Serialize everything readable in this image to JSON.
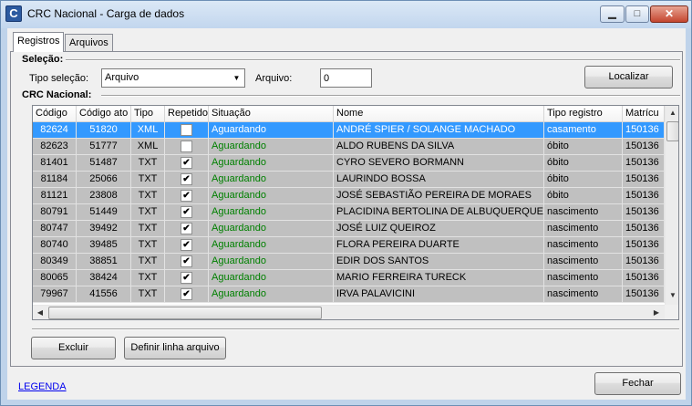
{
  "window": {
    "title": "CRC Nacional - Carga de dados",
    "icon_letter": "C"
  },
  "window_buttons": {
    "minimize": "▁",
    "maximize": "□",
    "close": "✕"
  },
  "tabs": [
    {
      "label": "Registros",
      "active": true
    },
    {
      "label": "Arquivos",
      "active": false
    }
  ],
  "selecao": {
    "group_label": "Seleção:",
    "tipo_label": "Tipo seleção:",
    "tipo_value": "Arquivo",
    "arquivo_label": "Arquivo:",
    "arquivo_value": "0",
    "localizar_label": "Localizar"
  },
  "crc": {
    "group_label": "CRC Nacional:",
    "columns": [
      "Código",
      "Código ato",
      "Tipo",
      "Repetido",
      "Situação",
      "Nome",
      "Tipo registro",
      "Matrícu"
    ],
    "rows": [
      {
        "codigo": "82624",
        "codigo_ato": "51820",
        "tipo": "XML",
        "repetido": false,
        "situacao": "Aguardando",
        "nome": "ANDRÉ SPIER / SOLANGE MACHADO",
        "tipo_registro": "casamento",
        "matricula": "150136",
        "selected": true
      },
      {
        "codigo": "82623",
        "codigo_ato": "51777",
        "tipo": "XML",
        "repetido": false,
        "situacao": "Aguardando",
        "nome": "ALDO RUBENS DA SILVA",
        "tipo_registro": "óbito",
        "matricula": "150136",
        "selected": false
      },
      {
        "codigo": "81401",
        "codigo_ato": "51487",
        "tipo": "TXT",
        "repetido": true,
        "situacao": "Aguardando",
        "nome": "CYRO SEVERO BORMANN",
        "tipo_registro": "óbito",
        "matricula": "150136",
        "selected": false
      },
      {
        "codigo": "81184",
        "codigo_ato": "25066",
        "tipo": "TXT",
        "repetido": true,
        "situacao": "Aguardando",
        "nome": "LAURINDO BOSSA",
        "tipo_registro": "óbito",
        "matricula": "150136",
        "selected": false
      },
      {
        "codigo": "81121",
        "codigo_ato": "23808",
        "tipo": "TXT",
        "repetido": true,
        "situacao": "Aguardando",
        "nome": "JOSÉ SEBASTIÃO PEREIRA DE MORAES",
        "tipo_registro": "óbito",
        "matricula": "150136",
        "selected": false
      },
      {
        "codigo": "80791",
        "codigo_ato": "51449",
        "tipo": "TXT",
        "repetido": true,
        "situacao": "Aguardando",
        "nome": "PLACIDINA BERTOLINA DE ALBUQUERQUE",
        "tipo_registro": "nascimento",
        "matricula": "150136",
        "selected": false
      },
      {
        "codigo": "80747",
        "codigo_ato": "39492",
        "tipo": "TXT",
        "repetido": true,
        "situacao": "Aguardando",
        "nome": "JOSÉ LUIZ QUEIROZ",
        "tipo_registro": "nascimento",
        "matricula": "150136",
        "selected": false
      },
      {
        "codigo": "80740",
        "codigo_ato": "39485",
        "tipo": "TXT",
        "repetido": true,
        "situacao": "Aguardando",
        "nome": "FLORA PEREIRA DUARTE",
        "tipo_registro": "nascimento",
        "matricula": "150136",
        "selected": false
      },
      {
        "codigo": "80349",
        "codigo_ato": "38851",
        "tipo": "TXT",
        "repetido": true,
        "situacao": "Aguardando",
        "nome": "EDIR DOS SANTOS",
        "tipo_registro": "nascimento",
        "matricula": "150136",
        "selected": false
      },
      {
        "codigo": "80065",
        "codigo_ato": "38424",
        "tipo": "TXT",
        "repetido": true,
        "situacao": "Aguardando",
        "nome": "MARIO FERREIRA TURECK",
        "tipo_registro": "nascimento",
        "matricula": "150136",
        "selected": false
      },
      {
        "codigo": "79967",
        "codigo_ato": "41556",
        "tipo": "TXT",
        "repetido": true,
        "situacao": "Aguardando",
        "nome": "IRVA PALAVICINI",
        "tipo_registro": "nascimento",
        "matricula": "150136",
        "selected": false
      }
    ]
  },
  "buttons": {
    "excluir": "Excluir",
    "definir": "Definir linha arquivo",
    "fechar": "Fechar"
  },
  "legenda": "LEGENDA",
  "icons": {
    "app": "app-icon",
    "combo_arrow": "▼",
    "scroll_up": "▲",
    "scroll_down": "▼",
    "scroll_left": "◀",
    "scroll_right": "▶",
    "check": "✔"
  },
  "colors": {
    "selected_row": "#3399ff",
    "row_bg": "#c0c0c0",
    "status_text": "#008000",
    "link": "#0000ee"
  }
}
